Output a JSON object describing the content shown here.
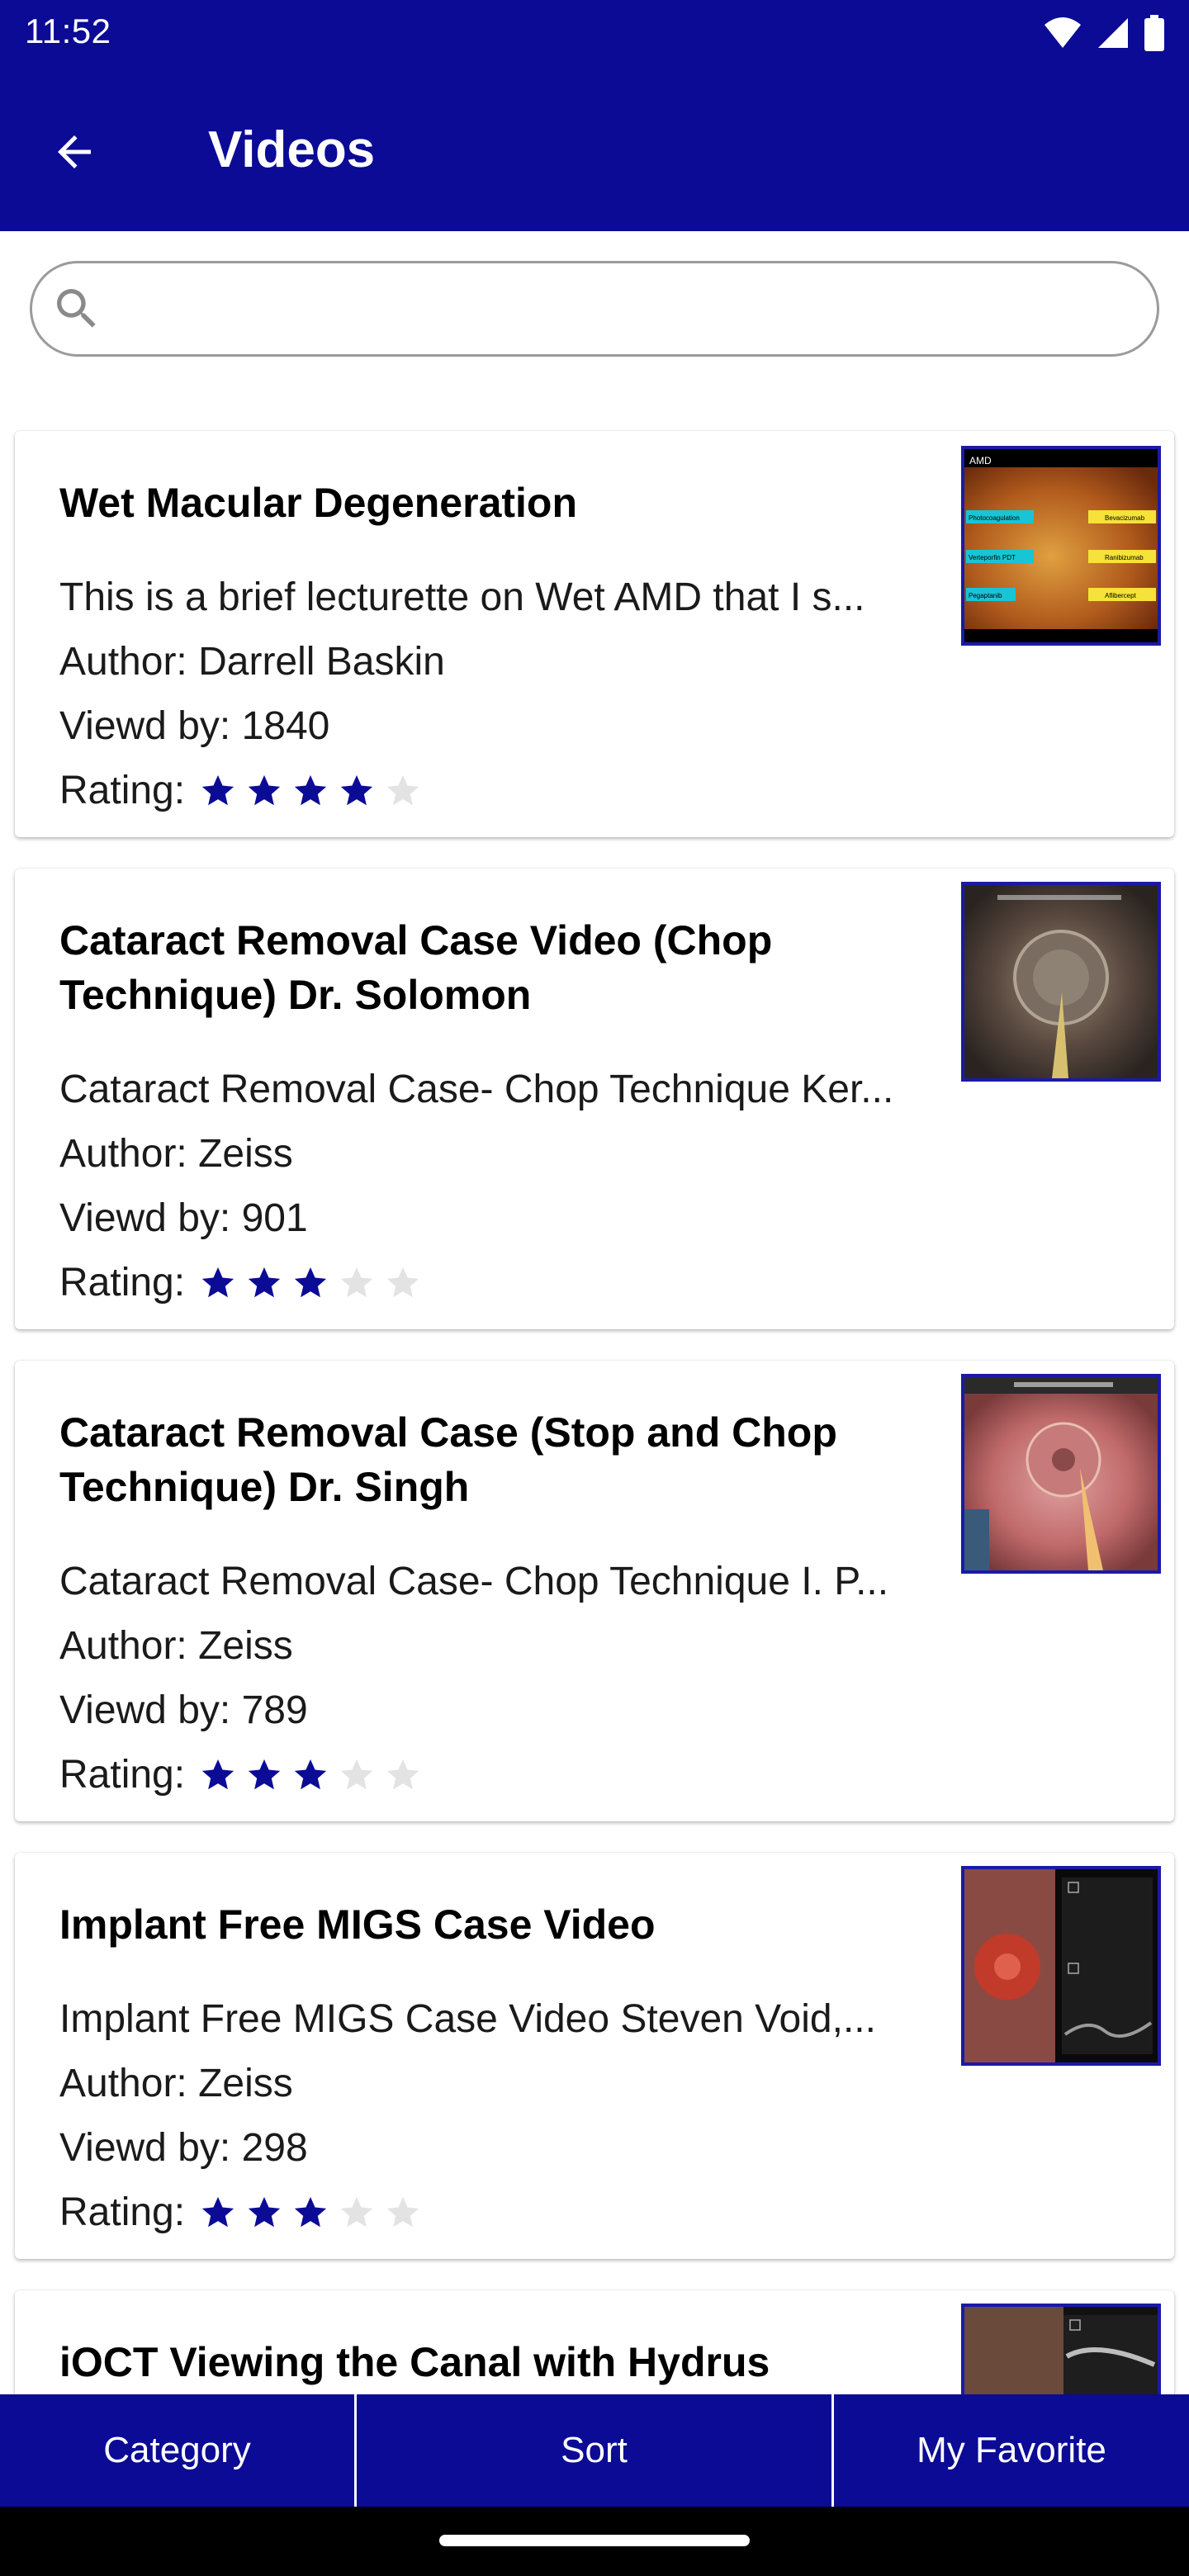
{
  "status": {
    "time": "11:52"
  },
  "appbar": {
    "title": "Videos"
  },
  "search": {
    "value": "",
    "placeholder": ""
  },
  "videos": [
    {
      "title": "Wet Macular Degeneration",
      "description": "This is a brief lecturette on Wet AMD that I s...",
      "author": "Author: Darrell Baskin",
      "views": "Viewd by: 1840",
      "rating_label": "Rating:",
      "rating": 4,
      "thumb_labels": [
        "AMD",
        "Photocoagulation",
        "Verteporfin PDT",
        "Pegaptanib",
        "Bevacizumab",
        "Ranibizumab",
        "Aflibercept"
      ]
    },
    {
      "title": "Cataract Removal Case Video (Chop Technique) Dr. Solomon",
      "description": "Cataract Removal Case- Chop Technique Ker...",
      "author": "Author: Zeiss",
      "views": "Viewd by: 901",
      "rating_label": "Rating:",
      "rating": 3
    },
    {
      "title": "Cataract Removal Case (Stop and Chop Technique) Dr. Singh",
      "description": "Cataract Removal Case- Chop Technique I. P...",
      "author": "Author: Zeiss",
      "views": "Viewd by: 789",
      "rating_label": "Rating:",
      "rating": 3
    },
    {
      "title": "Implant Free MIGS Case Video",
      "description": "Implant Free MIGS Case Video Steven Void,...",
      "author": "Author: Zeiss",
      "views": "Viewd by: 298",
      "rating_label": "Rating:",
      "rating": 3
    },
    {
      "title": "iOCT Viewing the Canal with Hydrus"
    }
  ],
  "tabs": {
    "category": "Category",
    "sort": "Sort",
    "favorite": "My Favorite"
  },
  "colors": {
    "primary": "#0b0b96",
    "star_filled": "#0b0b96",
    "star_empty": "#e3e3e3"
  },
  "icons": [
    "back-arrow-icon",
    "search-icon",
    "wifi-icon",
    "signal-icon",
    "battery-icon",
    "star-icon"
  ]
}
